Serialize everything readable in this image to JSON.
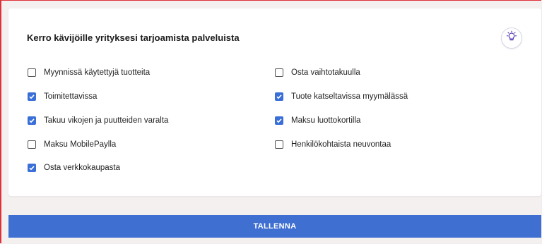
{
  "card": {
    "title": "Kerro kävijöille yrityksesi tarjoamista palveluista"
  },
  "options": [
    {
      "label": "Myynnissä käytettyjä tuotteita",
      "checked": false
    },
    {
      "label": "Toimitettavissa",
      "checked": true
    },
    {
      "label": "Takuu vikojen ja puutteiden varalta",
      "checked": true
    },
    {
      "label": "Maksu MobilePaylla",
      "checked": false
    },
    {
      "label": "Osta verkkokaupasta",
      "checked": true
    },
    {
      "label": "Osta vaihtotakuulla",
      "checked": false
    },
    {
      "label": "Tuote katseltavissa myymälässä",
      "checked": true
    },
    {
      "label": "Maksu luottokortilla",
      "checked": true
    },
    {
      "label": "Henkilökohtaista neuvontaa",
      "checked": false
    }
  ],
  "icons": {
    "tip": "lightbulb-icon",
    "check": "checkmark-icon"
  },
  "colors": {
    "accent": "#3f6fd1",
    "checkbox_checked": "#3a6fd8",
    "frame_border": "#e0303a",
    "bulb": "#5a3fb8"
  },
  "save_label": "TALLENNA"
}
